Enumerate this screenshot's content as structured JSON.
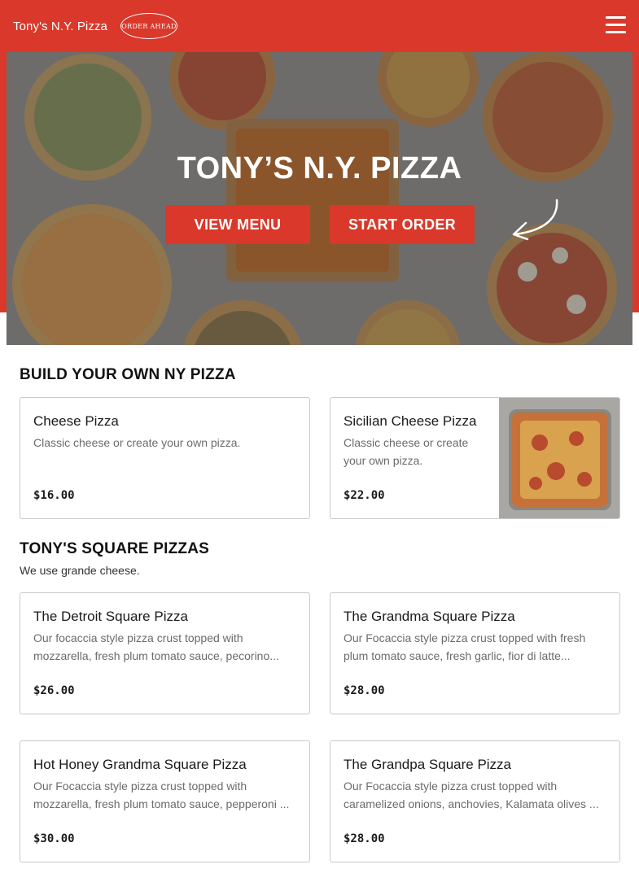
{
  "nav": {
    "brand": "Tony's N.Y. Pizza",
    "order_ahead": "ORDER AHEAD",
    "menu_icon": "hamburger-menu-icon"
  },
  "hero": {
    "title": "TONY’S N.Y. PIZZA",
    "view_menu": "VIEW MENU",
    "start_order": "START ORDER"
  },
  "sections": [
    {
      "title": "BUILD YOUR OWN NY PIZZA",
      "subtitle": "",
      "items": [
        {
          "name": "Cheese Pizza",
          "description": "Classic cheese or create your own pizza.",
          "price": "$16.00"
        },
        {
          "name": "Sicilian Cheese Pizza",
          "description": "Classic cheese or create your own pizza.",
          "price": "$22.00"
        }
      ]
    },
    {
      "title": "TONY'S SQUARE PIZZAS",
      "subtitle": "We use grande cheese.",
      "items": [
        {
          "name": "The Detroit Square Pizza",
          "description": "Our focaccia style pizza crust topped with mozzarella, fresh plum tomato sauce, pecorino...",
          "price": "$26.00"
        },
        {
          "name": "The Grandma Square Pizza",
          "description": "Our Focaccia style pizza crust topped with fresh plum tomato sauce, fresh garlic, fior di latte...",
          "price": "$28.00"
        },
        {
          "name": "Hot Honey Grandma Square Pizza",
          "description": "Our Focaccia style pizza crust topped with mozzarella, fresh plum tomato sauce, pepperoni ...",
          "price": "$30.00"
        },
        {
          "name": "The Grandpa Square Pizza",
          "description": "Our Focaccia style pizza crust topped with caramelized onions, anchovies, Kalamata olives ...",
          "price": "$28.00"
        }
      ]
    }
  ],
  "colors": {
    "brand_red": "#d9382b",
    "border": "#c9c9c9",
    "muted_text": "#6b6b6b"
  }
}
